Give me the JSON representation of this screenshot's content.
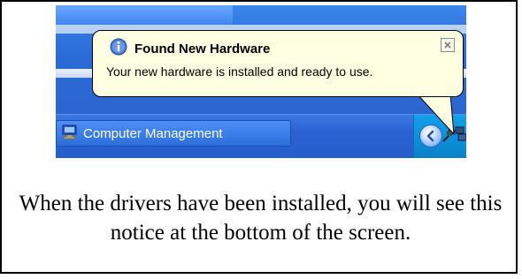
{
  "balloon": {
    "title": "Found New Hardware",
    "message": "Your new hardware is installed and ready to use.",
    "icon": "info-icon",
    "close_icon": "close-icon"
  },
  "taskbar": {
    "task_label": "Computer Management",
    "task_icon": "computer-icon",
    "tray_icons": [
      "show-hidden-icons-icon",
      "hardware-plug-icon",
      "network-icon"
    ]
  },
  "caption": "When the drivers have been installed, you will see this notice at the bottom of the screen.",
  "colors": {
    "balloon_bg": "#ffffe1",
    "taskbar_blue": "#245dcc",
    "tray_blue": "#0b8ed8"
  }
}
